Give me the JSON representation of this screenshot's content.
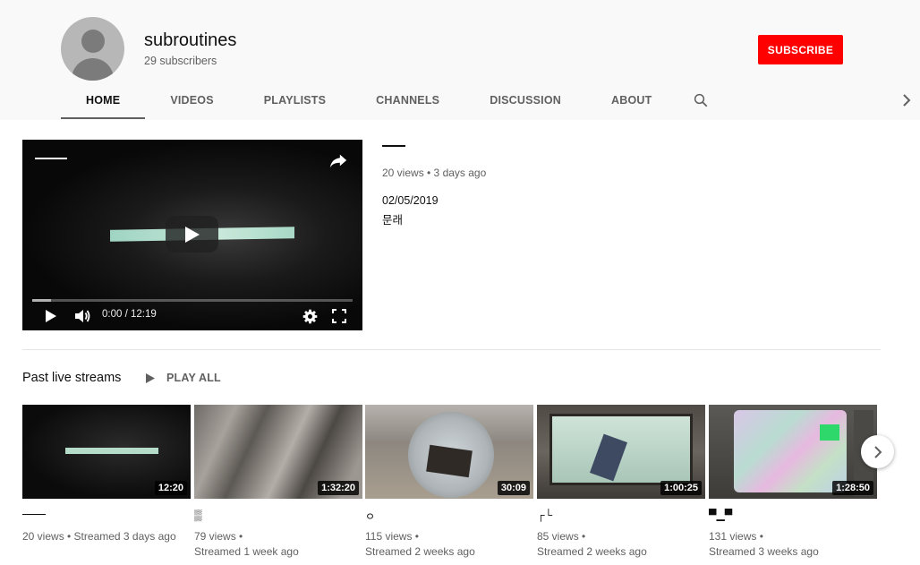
{
  "channel": {
    "name": "subroutines",
    "subscribers": "29 subscribers",
    "subscribe_label": "SUBSCRIBE"
  },
  "tabs": [
    {
      "label": "HOME",
      "active": true
    },
    {
      "label": "VIDEOS",
      "active": false
    },
    {
      "label": "PLAYLISTS",
      "active": false
    },
    {
      "label": "CHANNELS",
      "active": false
    },
    {
      "label": "DISCUSSION",
      "active": false
    },
    {
      "label": "ABOUT",
      "active": false
    }
  ],
  "icons": {
    "search": "search-icon",
    "tabs_next": "chevron-right-icon",
    "share": "share-icon",
    "play": "play-icon",
    "volume": "volume-icon",
    "settings": "gear-icon",
    "fullscreen": "fullscreen-icon",
    "shelf_next": "chevron-right-icon"
  },
  "featured": {
    "time": "0:00 / 12:19",
    "progress_fraction": 0.06,
    "meta": "20 views • 3 days ago",
    "date": "02/05/2019",
    "description": "문래"
  },
  "shelf": {
    "title": "Past live streams",
    "play_all": "PLAY ALL",
    "videos": [
      {
        "title": "",
        "duration": "12:20",
        "meta_line1": "20 views • Streamed 3 days ago",
        "meta_line2": ""
      },
      {
        "title": "▒",
        "duration": "1:32:20",
        "meta_line1": "79 views •",
        "meta_line2": "Streamed 1 week ago"
      },
      {
        "title": "ㅇ",
        "duration": "30:09",
        "meta_line1": "115 views •",
        "meta_line2": "Streamed 2 weeks ago"
      },
      {
        "title": "┌└",
        "duration": "1:00:25",
        "meta_line1": "85 views •",
        "meta_line2": "Streamed 2 weeks ago"
      },
      {
        "title": "▀▁▀",
        "duration": "1:28:50",
        "meta_line1": "131 views •",
        "meta_line2": "Streamed 3 weeks ago"
      }
    ]
  },
  "colors": {
    "subscribe": "#ff0000",
    "header_bg": "#f9f9f9",
    "text_secondary": "#606060"
  }
}
